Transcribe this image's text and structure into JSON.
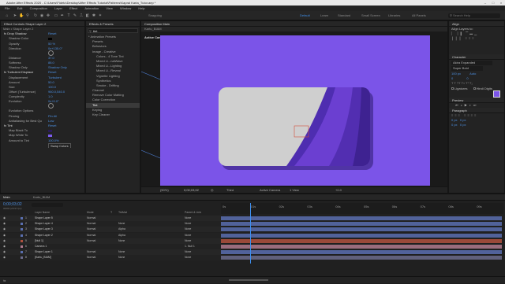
{
  "app": {
    "title": "Adobe After Effects 2020 - C:\\Users\\Fideto\\Desktop\\After Effects Tutorial\\Patterns\\Kapral Karta_Tutor.aep *"
  },
  "menu": [
    "File",
    "Edit",
    "Composition",
    "Layer",
    "Effect",
    "Animation",
    "View",
    "Window",
    "Help"
  ],
  "toolbar": {
    "snapping": "Snapping",
    "workspaces": [
      "Default",
      "Learn",
      "Standard",
      "Small Screen",
      "Libraries",
      "All Panels"
    ],
    "search_placeholder": "Search Help"
  },
  "effect_controls": {
    "tab": "Effect Controls Shape Layer 2",
    "layer": "Main • Shape Layer 2",
    "rows": [
      {
        "label": "Drop Shadow",
        "value": "Reset"
      },
      {
        "label": "Shadow Color",
        "value": ""
      },
      {
        "label": "Opacity",
        "value": "50 %"
      },
      {
        "label": "Direction",
        "value": "0x+135.0°"
      },
      {
        "label": "Distance",
        "value": "37.0"
      },
      {
        "label": "Softness",
        "value": "88.0"
      },
      {
        "label": "Shadow Only",
        "value": "Shadow Only"
      },
      {
        "label": "Turbulent Displace",
        "value": "Reset"
      },
      {
        "label": "Displacement",
        "value": "Turbulent"
      },
      {
        "label": "Amount",
        "value": "50.0"
      },
      {
        "label": "Size",
        "value": "100.0"
      },
      {
        "label": "Offset (Turbulence)",
        "value": "960.0,540.0"
      },
      {
        "label": "Complexity",
        "value": "1.0"
      },
      {
        "label": "Evolution",
        "value": "0x+0.0°"
      },
      {
        "label": "Evolution Options",
        "value": ""
      },
      {
        "label": "Pinning",
        "value": "Pin All"
      },
      {
        "label": "Antialiasing for Best Qu",
        "value": "Low"
      },
      {
        "label": "Tint",
        "value": "Reset"
      },
      {
        "label": "Map Black To",
        "value": ""
      },
      {
        "label": "Map White To",
        "value": ""
      },
      {
        "label": "Amount to Tint",
        "value": "100.0%"
      },
      {
        "label": "",
        "value": "Swap Colors"
      }
    ],
    "colors": {
      "shadow": "#000000",
      "black": "#2b1b5a",
      "white": "#7c5cf0"
    }
  },
  "effects_presets": {
    "tab": "Effects & Presets",
    "search": "tint",
    "items": [
      "* Animation Presets",
      "Presets",
      "Behaviors",
      "Image - Creative",
      "Colors - 4 Tone Tint",
      "Mixed Li...nalWave",
      "Mixed Li...Lighting",
      "Mixed Li...Reveal",
      "Vignette Lighting",
      "Synthetics",
      "Smoke - Drifting",
      "Channel",
      "Remove Color Matting",
      "Color Correction",
      "Tint",
      "Keying",
      "Key Cleaner"
    ]
  },
  "composition": {
    "tab": "Composition Main",
    "layer_tab": "Kartu_BIAM",
    "view_label": "Active Camera",
    "zoom": "(50%)",
    "timecode": "0;00;03;02",
    "resolution": "Third",
    "camera": "Active Camera",
    "views": "1 View",
    "exposure": "+0.0",
    "bg_color": "#7b54e8",
    "card_color": "#cfcfcf",
    "band_color": "#6b3fd1",
    "band_dark": "#4e2db0"
  },
  "right": {
    "align": "Align",
    "align_to": "Align Layers to:",
    "character": "Character",
    "font": "Akira Expanded",
    "style": "Super Bold",
    "sizes": [
      "100 px",
      "Auto",
      "0",
      "0"
    ],
    "preview": "Preview",
    "paragraph": "Paragraph",
    "ligatures": "Ligatures",
    "hindi": "Hindi Digits"
  },
  "timeline": {
    "tabs": [
      "Main",
      "Kartu_BIAM"
    ],
    "timecode": "0;00;03;02",
    "sub": "00092 (29.97 fps)",
    "columns": [
      "Layer Name",
      "Mode",
      "T",
      "TrkMat",
      "Parent & Link"
    ],
    "layers": [
      {
        "n": "1",
        "name": "Shape Layer 5",
        "mode": "Normal",
        "trk": "",
        "parent": "None",
        "color": "#5a6fb0"
      },
      {
        "n": "2",
        "name": "Shape Layer 4",
        "mode": "Normal",
        "trk": "None",
        "parent": "None",
        "color": "#5a6fb0"
      },
      {
        "n": "3",
        "name": "Shape Layer 3",
        "mode": "Normal",
        "trk": "Alpha",
        "parent": "None",
        "color": "#5a6fb0"
      },
      {
        "n": "4",
        "name": "Shape Layer 2",
        "mode": "Normal",
        "trk": "Alpha",
        "parent": "None",
        "color": "#5a6fb0"
      },
      {
        "n": "5",
        "name": "[Null 1]",
        "mode": "Normal",
        "trk": "None",
        "parent": "None",
        "color": "#b0513e"
      },
      {
        "n": "6",
        "name": "Camera 1",
        "mode": "",
        "trk": "",
        "parent": "1. Null 1",
        "color": "#b07a8e"
      },
      {
        "n": "7",
        "name": "Shape Layer 1",
        "mode": "Normal",
        "trk": "None",
        "parent": "None",
        "color": "#5a6fb0"
      },
      {
        "n": "8",
        "name": "[Kartu_BIAM]",
        "mode": "Normal",
        "trk": "None",
        "parent": "None",
        "color": "#6c6c8c"
      }
    ],
    "ruler": [
      "0s",
      "01s",
      "02s",
      "03s",
      "04s",
      "05s",
      "06s",
      "07s",
      "08s",
      "09s"
    ],
    "playhead_sec": 1.03,
    "duration_sec": 10
  }
}
